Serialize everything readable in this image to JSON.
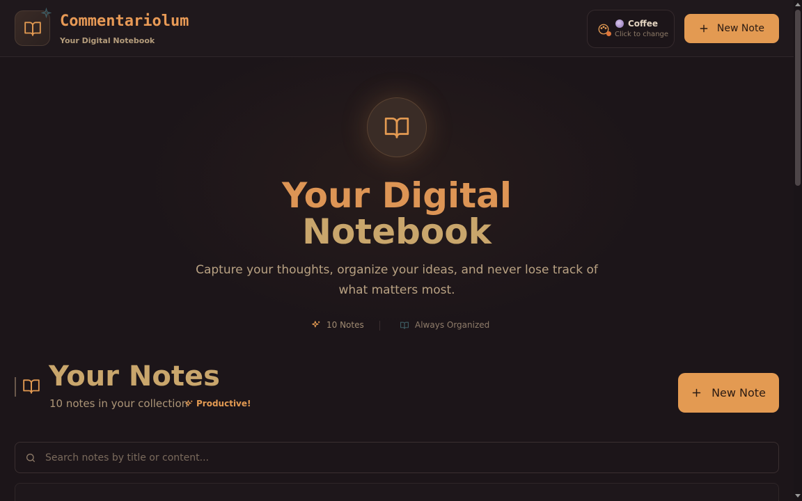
{
  "header": {
    "app_title": "Commentariolum",
    "app_subtitle": "Your Digital Notebook",
    "theme": {
      "name": "Coffee",
      "hint": "Click to change"
    },
    "new_note_label": "New Note"
  },
  "hero": {
    "title_line1": "Your Digital",
    "title_line2": "Notebook",
    "description": "Capture your thoughts, organize your ideas, and never lose track of what matters most.",
    "stats": [
      {
        "icon": "sparkles-icon",
        "label": "10 Notes"
      },
      {
        "icon": "book-open-icon",
        "label": "Always Organized"
      }
    ]
  },
  "notes": {
    "title": "Your Notes",
    "count_text": "10 notes in your collection",
    "badge": "Productive!",
    "new_note_label": "New Note",
    "search": {
      "placeholder": "Search notes by title or content...",
      "value": ""
    }
  },
  "colors": {
    "accent": "#e39a52",
    "background": "#1c1519",
    "gold": "#c9a66c"
  }
}
